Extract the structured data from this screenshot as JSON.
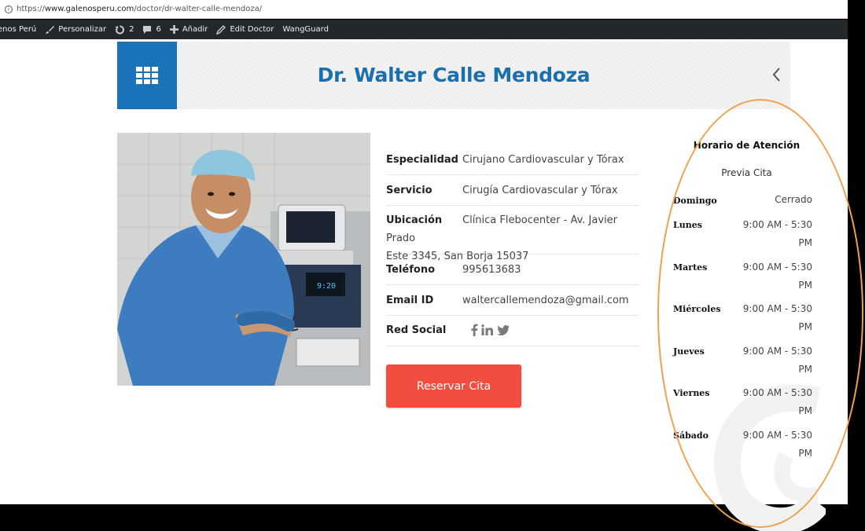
{
  "browser": {
    "url_prefix": "https://",
    "url_host": "www.galenosperu.com",
    "url_path": "/doctor/dr-walter-calle-mendoza/"
  },
  "admin_bar": {
    "site": "enos Perú",
    "customize": "Personalizar",
    "updates": "2",
    "comments": "6",
    "new": "Añadir",
    "edit": "Edit Doctor",
    "plugin": "WangGuard"
  },
  "header": {
    "title": "Dr. Walter Calle Mendoza"
  },
  "details": [
    {
      "label": "Especialidad",
      "value": "Cirujano Cardiovascular y Tórax"
    },
    {
      "label": "Servicio",
      "value": "Cirugía Cardiovascular y Tórax"
    },
    {
      "label": "Ubicación",
      "value": "Clínica Flebocenter - Av. Javier Prado",
      "value2": "Este 3345, San Borja 15037"
    },
    {
      "label": "Teléfono",
      "value": "995613683"
    },
    {
      "label": "Email ID",
      "value": "waltercallemendoza@gmail.com"
    },
    {
      "label": "Red Social",
      "value": ""
    }
  ],
  "reserve_button": "Reservar Cita",
  "schedule": {
    "title": "Horario de Atención",
    "subtitle": "Previa Cita",
    "days": [
      {
        "day": "Domingo",
        "hours": "Cerrado"
      },
      {
        "day": "Lunes",
        "hours": "9:00 AM - 5:30 PM"
      },
      {
        "day": "Martes",
        "hours": "9:00 AM - 5:30 PM"
      },
      {
        "day": "Miércoles",
        "hours": "9:00 AM - 5:30 PM"
      },
      {
        "day": "Jueves",
        "hours": "9:00 AM - 5:30 PM"
      },
      {
        "day": "Viernes",
        "hours": "9:00 AM - 5:30 PM"
      },
      {
        "day": "Sábado",
        "hours": "9:00 AM - 5:30 PM"
      }
    ]
  },
  "colors": {
    "brand_blue": "#1a73b9",
    "title_blue": "#1a6fae",
    "reserve_red": "#f24e3f",
    "highlight_oval": "#f0a14c",
    "admin_bar": "#23282d"
  },
  "icons": [
    "info-icon",
    "brush-icon",
    "refresh-icon",
    "comment-icon",
    "plus-icon",
    "pencil-icon",
    "grid-icon",
    "chevron-left-icon",
    "facebook-icon",
    "linkedin-icon",
    "twitter-icon"
  ]
}
